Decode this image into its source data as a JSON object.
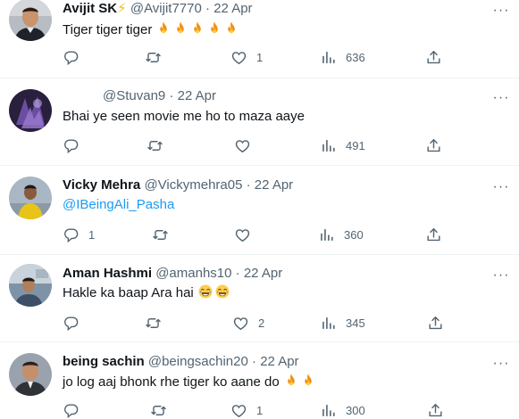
{
  "tweets": [
    {
      "name": "Avijit SK",
      "badge": "⚡",
      "handle": "@Avijit7770",
      "dot": "·",
      "date": "22 Apr",
      "text": "Tiger tiger tiger",
      "fire_count": 5,
      "reply_count": "",
      "retweet_count": "",
      "like_count": "1",
      "view_count": "636",
      "avatar": "man-in-dark-jacket-avatar"
    },
    {
      "name": "",
      "handle": "@Stuvan9",
      "dot": "·",
      "date": "22 Apr",
      "text": "Bhai ye seen movie me ho to maza aaye",
      "reply_count": "",
      "retweet_count": "",
      "like_count": "",
      "view_count": "491",
      "avatar": "purple-abstract-avatar"
    },
    {
      "name": "Vicky Mehra",
      "handle": "@Vickymehra05",
      "dot": "·",
      "date": "22 Apr",
      "mention": "@IBeingAli_Pasha",
      "reply_count": "1",
      "retweet_count": "",
      "like_count": "",
      "view_count": "360",
      "avatar": "person-in-yellow-shirt-avatar"
    },
    {
      "name": "Aman Hashmi",
      "handle": "@amanhs10",
      "dot": "·",
      "date": "22 Apr",
      "text": "Hakle ka baap Ara hai",
      "laugh_count": 2,
      "reply_count": "",
      "retweet_count": "",
      "like_count": "2",
      "view_count": "345",
      "avatar": "man-indoors-avatar"
    },
    {
      "name": "being sachin",
      "handle": "@beingsachin20",
      "dot": "·",
      "date": "22 Apr",
      "text": "jo log aaj bhonk rhe tiger ko aane do",
      "fire_count": 2,
      "reply_count": "",
      "retweet_count": "",
      "like_count": "1",
      "view_count": "300",
      "avatar": "man-in-suit-avatar"
    }
  ],
  "more_glyph": "···",
  "colors": {
    "text": "#0f1419",
    "muted": "#536471",
    "link": "#1d9bf0",
    "divider": "#eff3f4"
  }
}
